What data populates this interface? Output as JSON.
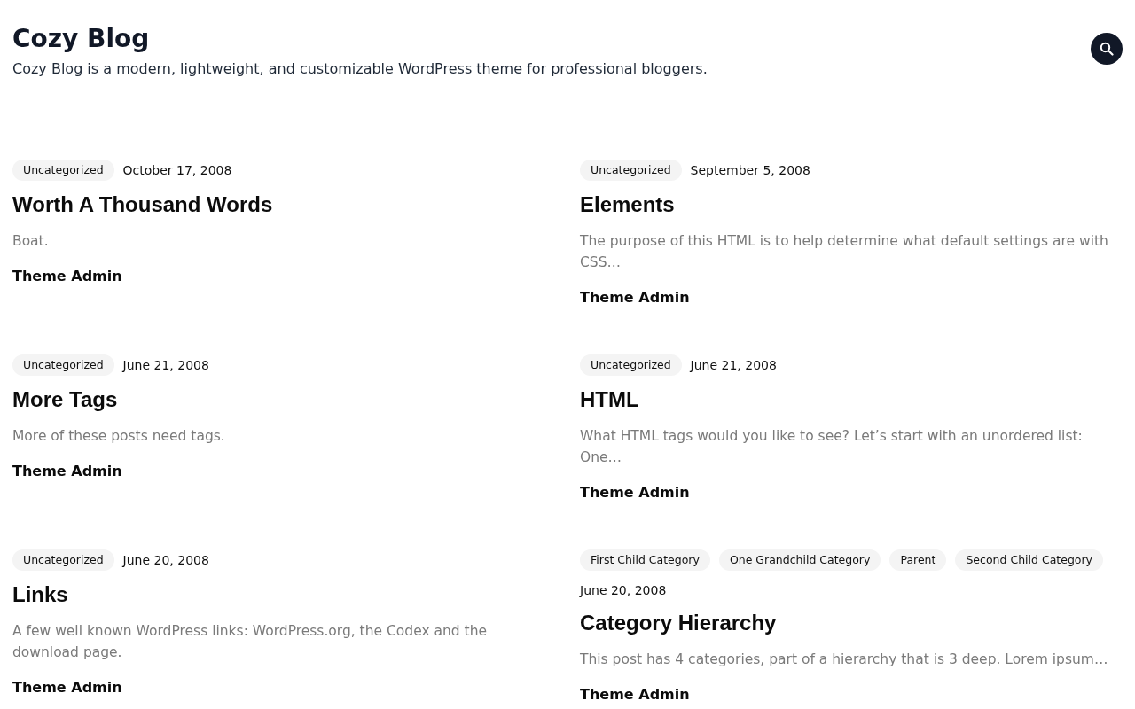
{
  "header": {
    "site_title": "Cozy Blog",
    "tagline": "Cozy Blog is a modern, lightweight, and customizable WordPress theme for professional bloggers."
  },
  "posts": [
    {
      "categories": [
        "Uncategorized"
      ],
      "date": "October 17, 2008",
      "title": "Worth A Thousand Words",
      "excerpt": "Boat.",
      "author": "Theme Admin"
    },
    {
      "categories": [
        "Uncategorized"
      ],
      "date": "September 5, 2008",
      "title": "Elements",
      "excerpt": "The purpose of this HTML is to help determine what default settings are with CSS…",
      "author": "Theme Admin"
    },
    {
      "categories": [
        "Uncategorized"
      ],
      "date": "June 21, 2008",
      "title": "More Tags",
      "excerpt": "More of these posts need tags.",
      "author": "Theme Admin"
    },
    {
      "categories": [
        "Uncategorized"
      ],
      "date": "June 21, 2008",
      "title": "HTML",
      "excerpt": "What HTML tags would you like to see? Let’s start with an unordered list: One…",
      "author": "Theme Admin"
    },
    {
      "categories": [
        "Uncategorized"
      ],
      "date": "June 20, 2008",
      "title": "Links",
      "excerpt": "A few well known WordPress links: WordPress.org, the Codex and the download page.",
      "author": "Theme Admin"
    },
    {
      "categories": [
        "First Child Category",
        "One Grandchild Category",
        "Parent",
        "Second Child Category"
      ],
      "date": "June 20, 2008",
      "title": "Category Hierarchy",
      "excerpt": "This post has 4 categories, part of a hierarchy that is 3 deep. Lorem ipsum…",
      "author": "Theme Admin"
    }
  ]
}
